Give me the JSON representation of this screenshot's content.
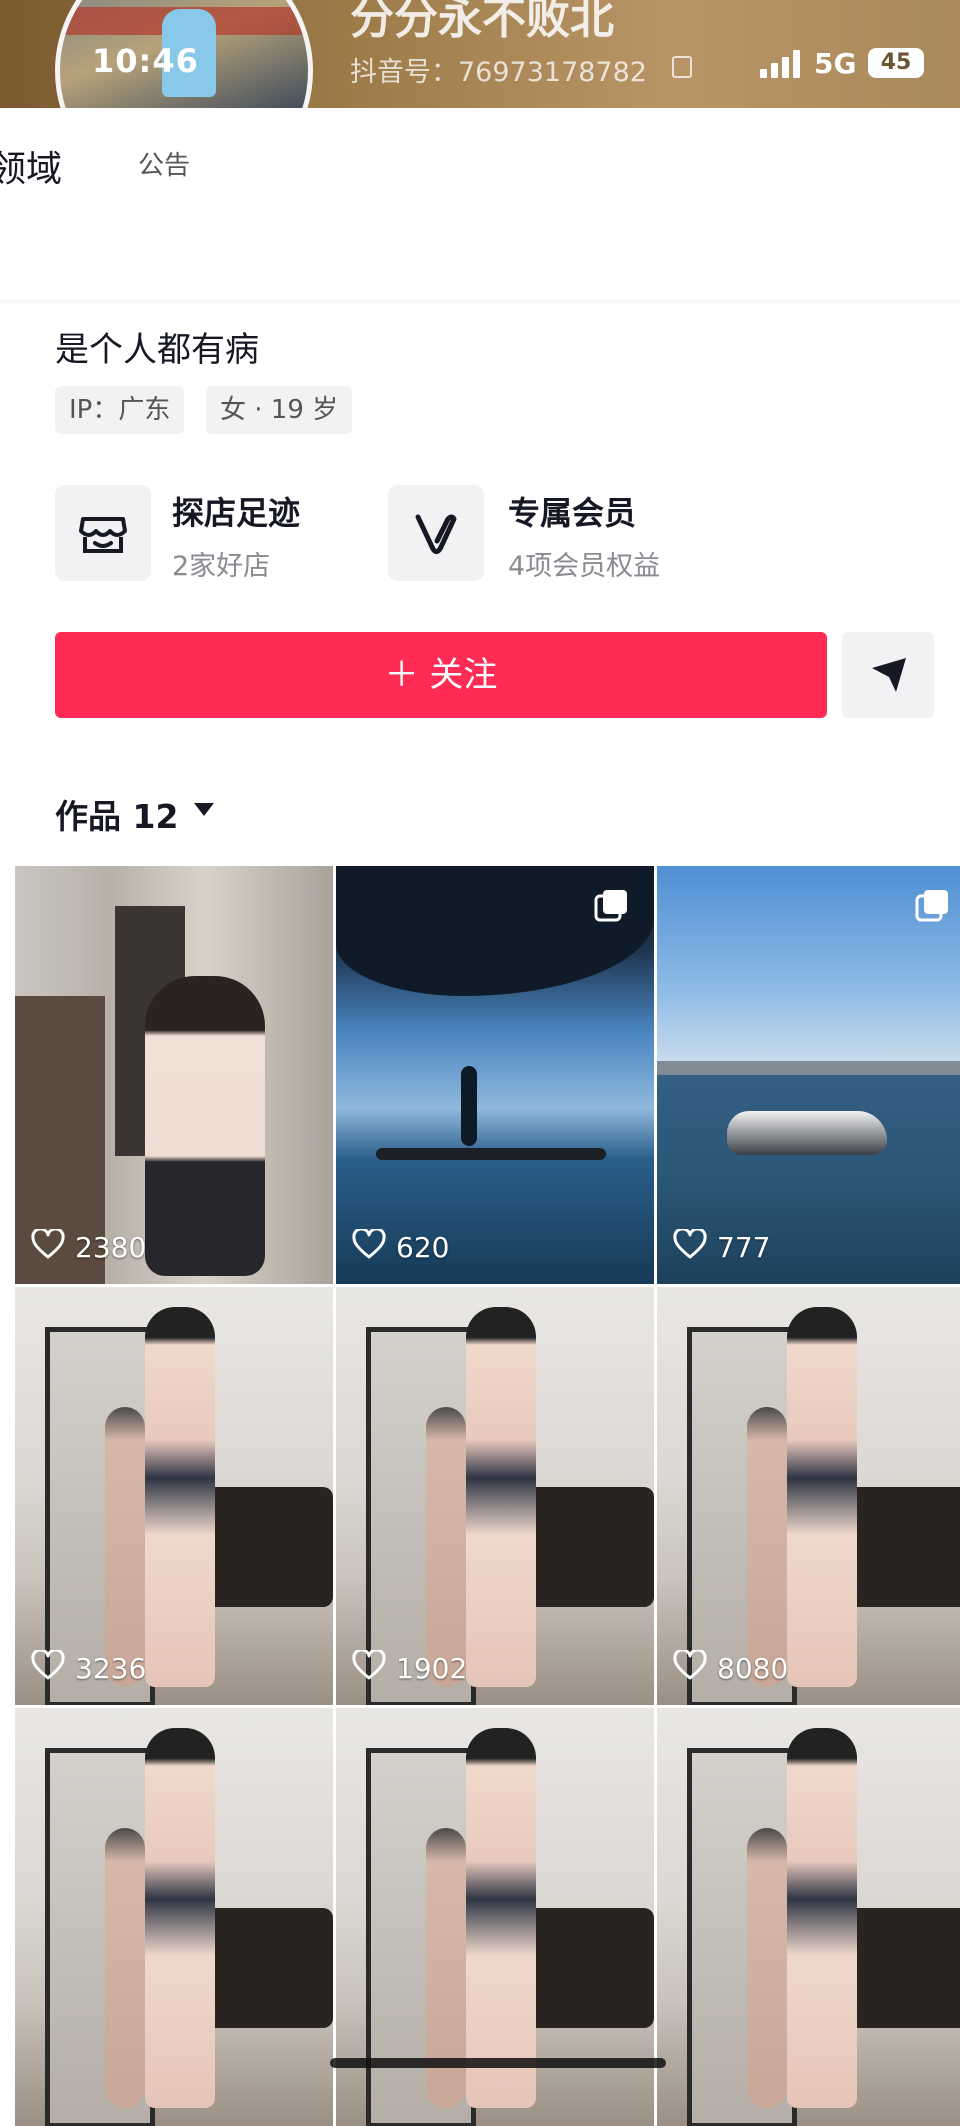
{
  "status_bar": {
    "time": "10:46",
    "network": "5G",
    "battery": "45"
  },
  "profile": {
    "nickname": "分分永不败北",
    "douyin_id": "抖音号：76973178782",
    "bio": "是个人都有病",
    "tags": [
      "IP：广东",
      "女 · 19 岁"
    ]
  },
  "tabs": {
    "domain": "领域",
    "notice": "公告"
  },
  "cards": [
    {
      "title": "探店足迹",
      "subtitle": "2家好店",
      "icon": "store-icon"
    },
    {
      "title": "专属会员",
      "subtitle": "4项会员权益",
      "icon": "vip-v-icon"
    }
  ],
  "actions": {
    "follow": "＋ 关注",
    "share_icon": "send-icon"
  },
  "works": {
    "label": "作品 12"
  },
  "grid": [
    {
      "likes": "2380",
      "multi": false,
      "scene": "mirror-selfie"
    },
    {
      "likes": "620",
      "multi": true,
      "scene": "paddleboard-sea"
    },
    {
      "likes": "777",
      "multi": true,
      "scene": "jetski-sea"
    },
    {
      "likes": "3236",
      "multi": false,
      "scene": "dance-room"
    },
    {
      "likes": "1902",
      "multi": false,
      "scene": "dance-room"
    },
    {
      "likes": "8080",
      "multi": false,
      "scene": "dance-room"
    },
    {
      "likes": "",
      "multi": false,
      "scene": "dance-room"
    },
    {
      "likes": "",
      "multi": false,
      "scene": "dance-room"
    },
    {
      "likes": "",
      "multi": false,
      "scene": "dance-room"
    }
  ],
  "colors": {
    "accent": "#fe2c55",
    "text": "#161823",
    "muted": "#8a8b91",
    "chip_bg": "#f2f2f4"
  }
}
